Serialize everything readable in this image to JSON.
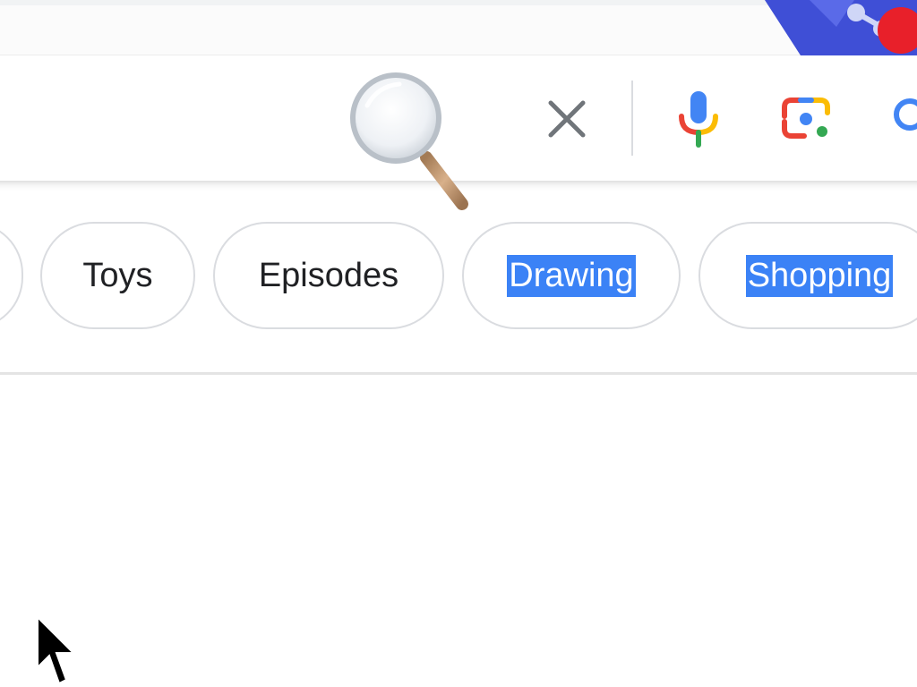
{
  "search_bar": {
    "clear_icon": "close-icon",
    "voice_icon": "microphone-icon",
    "lens_icon": "camera-lens-icon",
    "search_icon": "search-icon"
  },
  "chips": [
    {
      "label": ""
    },
    {
      "label": "Toys"
    },
    {
      "label": "Episodes"
    },
    {
      "label": "Drawing",
      "selected_text": true
    },
    {
      "label": "Shopping",
      "selected_text": true
    }
  ],
  "colors": {
    "selection_highlight": "#3b82f6",
    "chip_border": "#dadce0",
    "text": "#202124",
    "google_blue": "#4285f4",
    "google_red": "#ea4335",
    "google_yellow": "#fbbc05",
    "google_green": "#34a853"
  }
}
